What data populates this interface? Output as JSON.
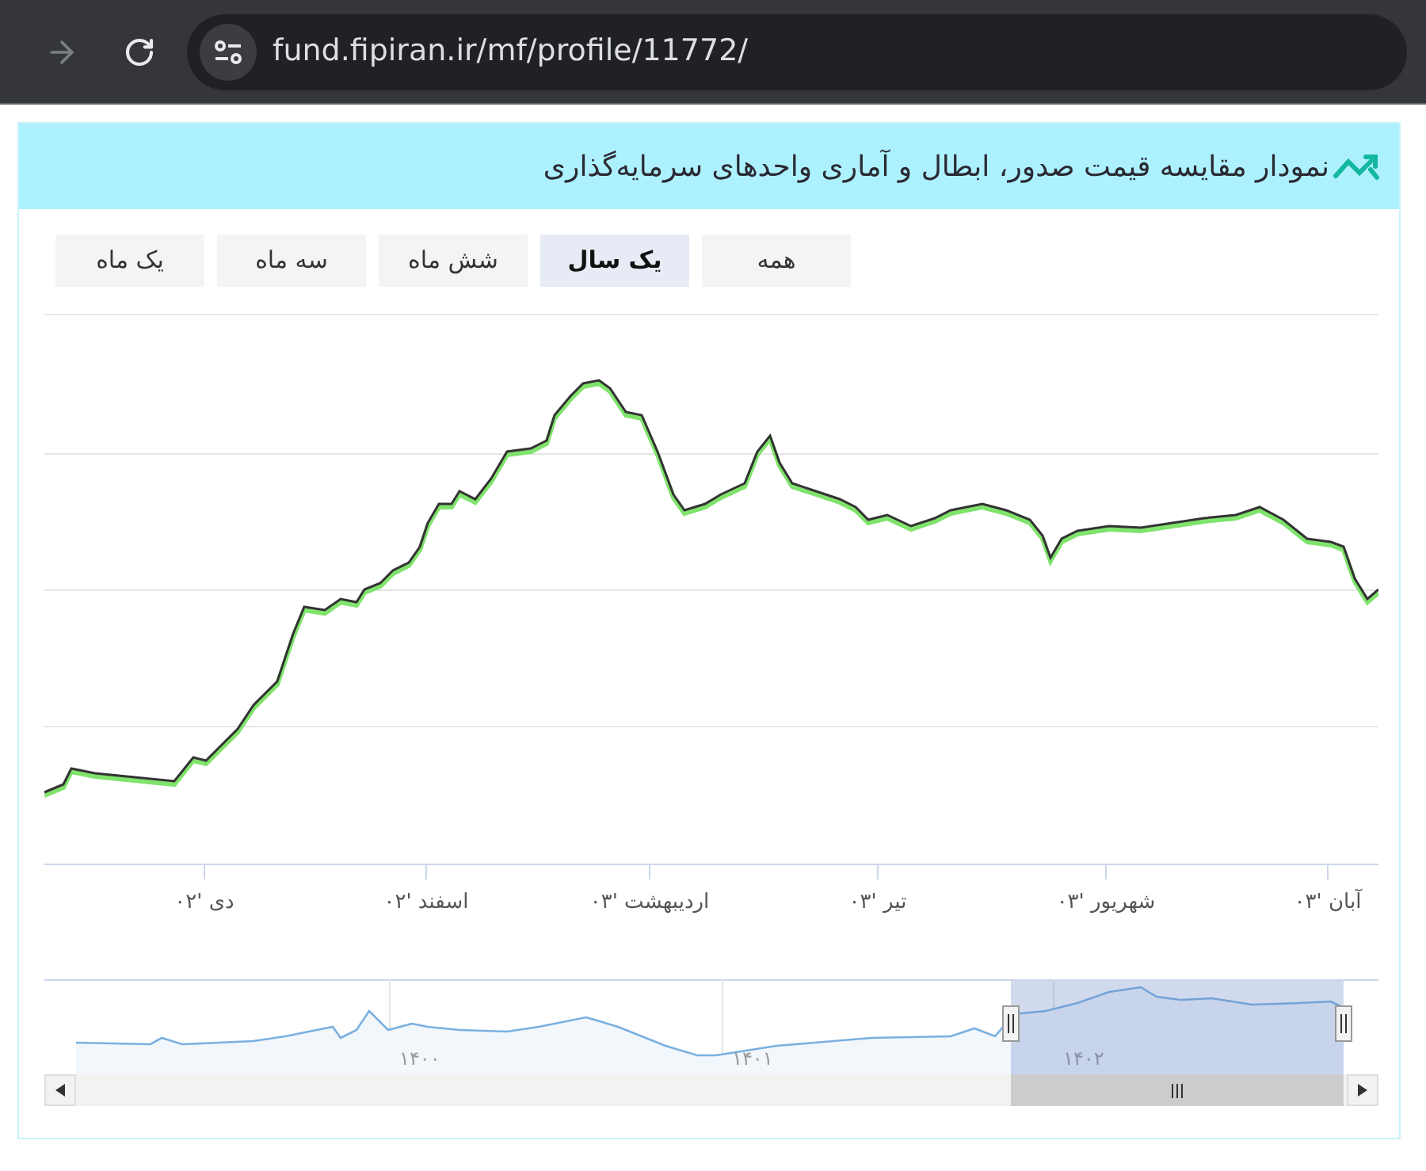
{
  "browser": {
    "url": "fund.fipiran.ir/mf/profile/11772/",
    "forward_disabled": true
  },
  "panel": {
    "title": "نمودار مقایسه قیمت صدور، ابطال و آماری واحدهای سرمایه‌گذاری",
    "ranges": [
      {
        "label": "همه",
        "selected": false
      },
      {
        "label": "یک سال",
        "selected": true
      },
      {
        "label": "شش ماه",
        "selected": false
      },
      {
        "label": "سه ماه",
        "selected": false
      },
      {
        "label": "یک ماه",
        "selected": false
      }
    ],
    "x_axis_labels": [
      "آبان '۰۳",
      "شهریور '۰۳",
      "تیر '۰۳",
      "اردیبهشت '۰۳",
      "اسفند '۰۲",
      "دی '۰۲"
    ],
    "navigator_labels": [
      "۱۴۰۲",
      "۱۴۰۱",
      "۱۴۰۰"
    ]
  }
}
